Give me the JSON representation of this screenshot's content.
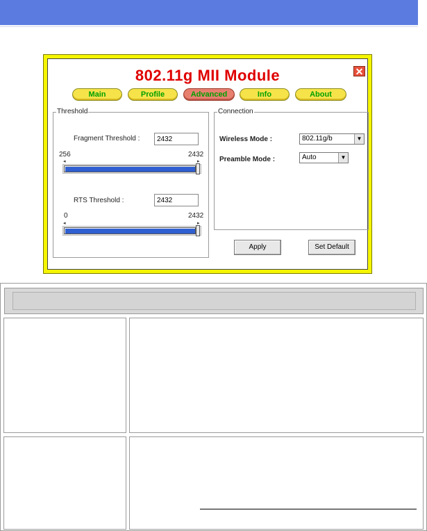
{
  "app": {
    "title": "802.11g MII Module",
    "close_glyph": "✕"
  },
  "tabs": [
    {
      "label": "Main",
      "active": false
    },
    {
      "label": "Profile",
      "active": false
    },
    {
      "label": "Advanced",
      "active": true
    },
    {
      "label": "Info",
      "active": false
    },
    {
      "label": "About",
      "active": false
    }
  ],
  "threshold": {
    "group_label": "Threshold",
    "fragment": {
      "label": "Fragment Threshold :",
      "value": "2432",
      "min_label": "256",
      "max_label": "2432",
      "fraction": 1.0
    },
    "rts": {
      "label": "RTS Threshold :",
      "value": "2432",
      "min_label": "0",
      "max_label": "2432",
      "fraction": 1.0
    }
  },
  "connection": {
    "group_label": "Connection",
    "wireless_mode_label": "Wireless Mode :",
    "wireless_mode_value": "802.11g/b",
    "preamble_mode_label": "Preamble Mode :",
    "preamble_mode_value": "Auto"
  },
  "buttons": {
    "apply": "Apply",
    "set_default": "Set Default"
  },
  "colors": {
    "banner": "#5b7be0",
    "window_frame": "#f5f500",
    "title": "#e00000",
    "tab_text": "#00a000",
    "slider_fill": "#2f5fd0"
  }
}
